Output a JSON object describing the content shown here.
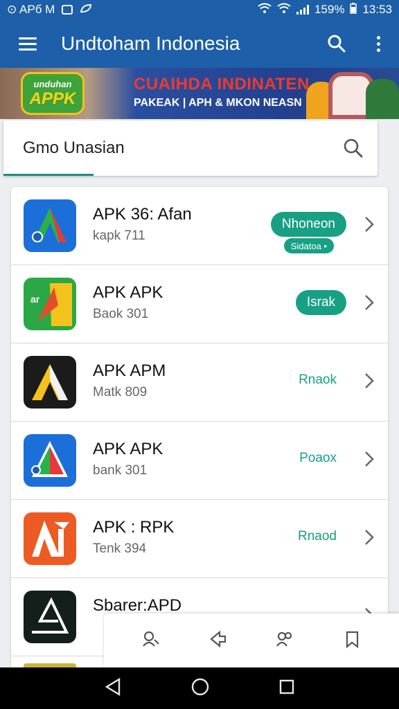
{
  "status": {
    "left_text": "⊙ APб M",
    "battery": "159%",
    "time": "13:53"
  },
  "appbar": {
    "title": "Undtoham Indonesia",
    "menu_icon": "hamburger-icon",
    "search_icon": "search-icon",
    "more_icon": "more-vert-icon"
  },
  "banner": {
    "logo_top": "unduhan",
    "logo_main": "APPK",
    "headline": "CUAIHDA INDINATEN",
    "subline": "PAKEAK | APH & MKON NEASN"
  },
  "search": {
    "query": "Gmo Unasian"
  },
  "apps": [
    {
      "name": "APK 36: Afan",
      "sub": "kapk 711",
      "action": "Nhoneon",
      "tag": "Sidatoa •",
      "style": "pill"
    },
    {
      "name": "APK APK",
      "sub": "Baok 301",
      "action": "Israk",
      "style": "pill"
    },
    {
      "name": "APK APM",
      "sub": "Matk 809",
      "action": "Rnaok",
      "style": "text"
    },
    {
      "name": "APK APK",
      "sub": "bank 301",
      "action": "Poaox",
      "style": "text"
    },
    {
      "name": "APK : RPK",
      "sub": "Tenk 394",
      "action": "Rnaod",
      "style": "text"
    },
    {
      "name": "Sbarer:APD",
      "sub": "",
      "action": "",
      "style": "text"
    }
  ],
  "colors": {
    "primary": "#1d5fa8",
    "accent": "#17a084"
  },
  "tabbar": [
    "people-search-icon",
    "share-icon",
    "group-icon",
    "bookmark-icon"
  ],
  "navbar": [
    "back-icon",
    "home-icon",
    "recents-icon"
  ]
}
